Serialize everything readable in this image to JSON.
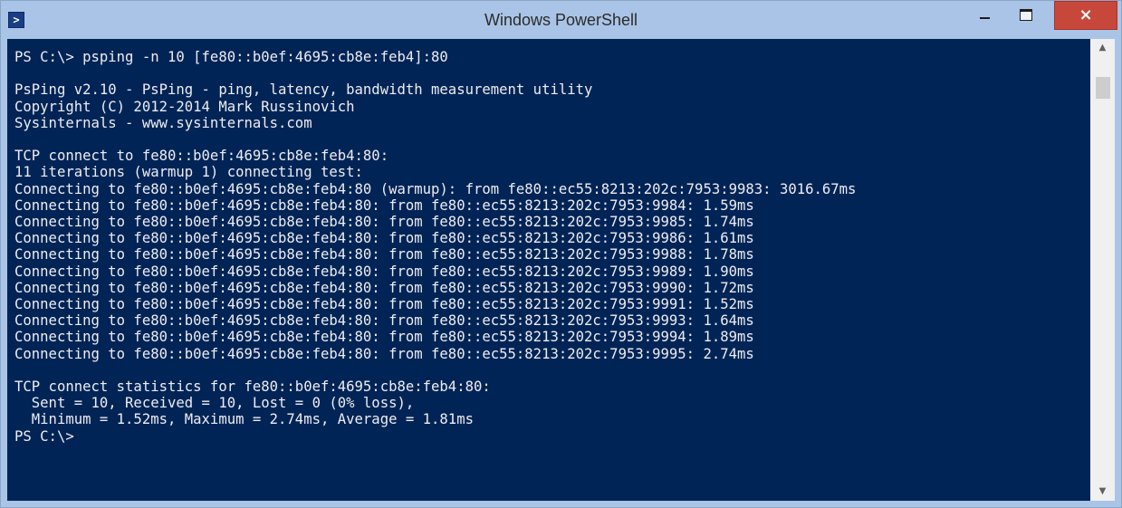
{
  "window": {
    "title": "Windows PowerShell",
    "close_label": "×"
  },
  "icons": {
    "app": "powershell-icon",
    "minimize": "minimize-icon",
    "maximize": "maximize-icon",
    "close": "close-icon",
    "scroll_up": "chevron-up-icon",
    "scroll_down": "chevron-down-icon"
  },
  "console": {
    "lines": [
      "PS C:\\> psping -n 10 [fe80::b0ef:4695:cb8e:feb4]:80",
      "",
      "PsPing v2.10 - PsPing - ping, latency, bandwidth measurement utility",
      "Copyright (C) 2012-2014 Mark Russinovich",
      "Sysinternals - www.sysinternals.com",
      "",
      "TCP connect to fe80::b0ef:4695:cb8e:feb4:80:",
      "11 iterations (warmup 1) connecting test:",
      "Connecting to fe80::b0ef:4695:cb8e:feb4:80 (warmup): from fe80::ec55:8213:202c:7953:9983: 3016.67ms",
      "Connecting to fe80::b0ef:4695:cb8e:feb4:80: from fe80::ec55:8213:202c:7953:9984: 1.59ms",
      "Connecting to fe80::b0ef:4695:cb8e:feb4:80: from fe80::ec55:8213:202c:7953:9985: 1.74ms",
      "Connecting to fe80::b0ef:4695:cb8e:feb4:80: from fe80::ec55:8213:202c:7953:9986: 1.61ms",
      "Connecting to fe80::b0ef:4695:cb8e:feb4:80: from fe80::ec55:8213:202c:7953:9988: 1.78ms",
      "Connecting to fe80::b0ef:4695:cb8e:feb4:80: from fe80::ec55:8213:202c:7953:9989: 1.90ms",
      "Connecting to fe80::b0ef:4695:cb8e:feb4:80: from fe80::ec55:8213:202c:7953:9990: 1.72ms",
      "Connecting to fe80::b0ef:4695:cb8e:feb4:80: from fe80::ec55:8213:202c:7953:9991: 1.52ms",
      "Connecting to fe80::b0ef:4695:cb8e:feb4:80: from fe80::ec55:8213:202c:7953:9993: 1.64ms",
      "Connecting to fe80::b0ef:4695:cb8e:feb4:80: from fe80::ec55:8213:202c:7953:9994: 1.89ms",
      "Connecting to fe80::b0ef:4695:cb8e:feb4:80: from fe80::ec55:8213:202c:7953:9995: 2.74ms",
      "",
      "TCP connect statistics for fe80::b0ef:4695:cb8e:feb4:80:",
      "  Sent = 10, Received = 10, Lost = 0 (0% loss),",
      "  Minimum = 1.52ms, Maximum = 2.74ms, Average = 1.81ms",
      "PS C:\\>"
    ]
  },
  "colors": {
    "console_background": "#012456",
    "console_text": "#eeedf0",
    "titlebar": "#a9c4e6",
    "close_button": "#c8473b"
  }
}
